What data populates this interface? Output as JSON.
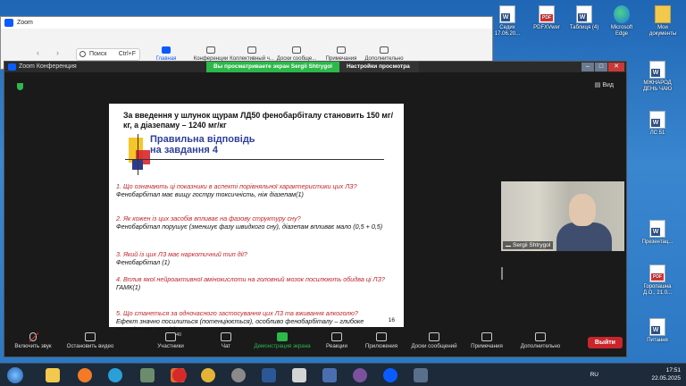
{
  "desktop": {
    "icons_top": [
      {
        "label": "Седих 17.06.20...",
        "type": "word"
      },
      {
        "label": "PDFXVwer",
        "type": "pdf"
      },
      {
        "label": "Таблиця (4)",
        "type": "word"
      },
      {
        "label": "Microsoft Edge",
        "type": "edge"
      },
      {
        "label": "Мои документы",
        "type": "folder"
      }
    ],
    "icons_right": [
      {
        "label": "МЖНАРОД ДЕНЬ ЧАЮ",
        "type": "word"
      },
      {
        "label": "ЛС 51",
        "type": "word"
      },
      {
        "label": "Презентац...",
        "type": "word"
      },
      {
        "label": "Горопашна Д.О., 21.0...",
        "type": "pdf"
      },
      {
        "label": "Питання",
        "type": "word"
      }
    ]
  },
  "zoom_main": {
    "title": "Zoom",
    "search_placeholder": "Поиск",
    "search_shortcut": "Ctrl+F",
    "tabs": [
      {
        "label": "Главная",
        "icon": "home-icon",
        "active": true
      },
      {
        "label": "Конференции",
        "icon": "calendar-icon",
        "active": false
      },
      {
        "label": "Коллективный ч...",
        "icon": "chat-icon",
        "active": false
      },
      {
        "label": "Доски сообще...",
        "icon": "whiteboard-icon",
        "active": false
      },
      {
        "label": "Примечания",
        "icon": "notes-icon",
        "active": false
      },
      {
        "label": "Дополнительно",
        "icon": "more-icon",
        "active": false
      }
    ]
  },
  "meeting": {
    "title": "Zoom Конференция",
    "banner_text": "Вы просматриваете экран Sergii Shtrygol",
    "view_options": "Настройки просмотра",
    "view_label": "Вид",
    "participant_name": "Sergii Shtrygol",
    "participants_count": "40",
    "leave_label": "Выйти",
    "toolbar": [
      {
        "label": "Включить звук",
        "icon": "mic-muted-icon"
      },
      {
        "label": "Остановить видео",
        "icon": "video-icon"
      },
      {
        "label": "Участники",
        "icon": "participants-icon"
      },
      {
        "label": "Чат",
        "icon": "chat-icon"
      },
      {
        "label": "Демонстрация экрана",
        "icon": "share-screen-icon"
      },
      {
        "label": "Реакции",
        "icon": "reactions-icon"
      },
      {
        "label": "Приложения",
        "icon": "apps-icon"
      },
      {
        "label": "Доски сообщений",
        "icon": "whiteboard-icon"
      },
      {
        "label": "Примечания",
        "icon": "notes-icon"
      },
      {
        "label": "Дополнительно",
        "icon": "more-icon"
      }
    ]
  },
  "slide": {
    "header": "За введення у шлунок щурам ЛД50 фенобарбіталу становить 150 мг/кг, а діазепаму – 1240 мг/кг",
    "answer_title_line1": "Правильна відповідь",
    "answer_title_line2": "на завдання 4",
    "qa": [
      {
        "q": "1. Що означають ці показники в аспекті порівняльної характеристики цих ЛЗ?",
        "a": "Фенобарбітал має вищу гостру токсичність, ніж діазепам(1)"
      },
      {
        "q": "2. Як кожен із цих засобів впливає на фазову структуру сну?",
        "a": "Фенобарбітал порушує (зменшує фазу швидкого сну), діазепам впливає мало (0,5 + 0,5)"
      },
      {
        "q": "3. Який із цих ЛЗ має наркотичний тип дії?",
        "a": "Фенобарбітал (1)"
      },
      {
        "q": "4. Вплив якої нейроактивної амінокислоти на головний мозок посилюють обидва ці ЛЗ?",
        "a": "ГАМК(1)"
      },
      {
        "q": "5. Що станеться за одночасного застосування цих ЛЗ та вживання алкоголю?",
        "a": "Ефект значно посилиться (потенціюється), особливо фенобарбіталу – глибоке пригнічення ЦНС(1)"
      }
    ],
    "page_number": "16"
  },
  "taskbar": {
    "language": "RU",
    "time": "17:51",
    "date": "22.05.2025",
    "apps": [
      "explorer-icon",
      "firefox-icon",
      "edge-icon",
      "calculator-icon",
      "media-icon",
      "opera-icon",
      "chrome-icon",
      "settings-icon",
      "word-icon",
      "notepad-icon",
      "store-icon",
      "viber-icon",
      "zoom-icon",
      "stack-icon"
    ]
  }
}
